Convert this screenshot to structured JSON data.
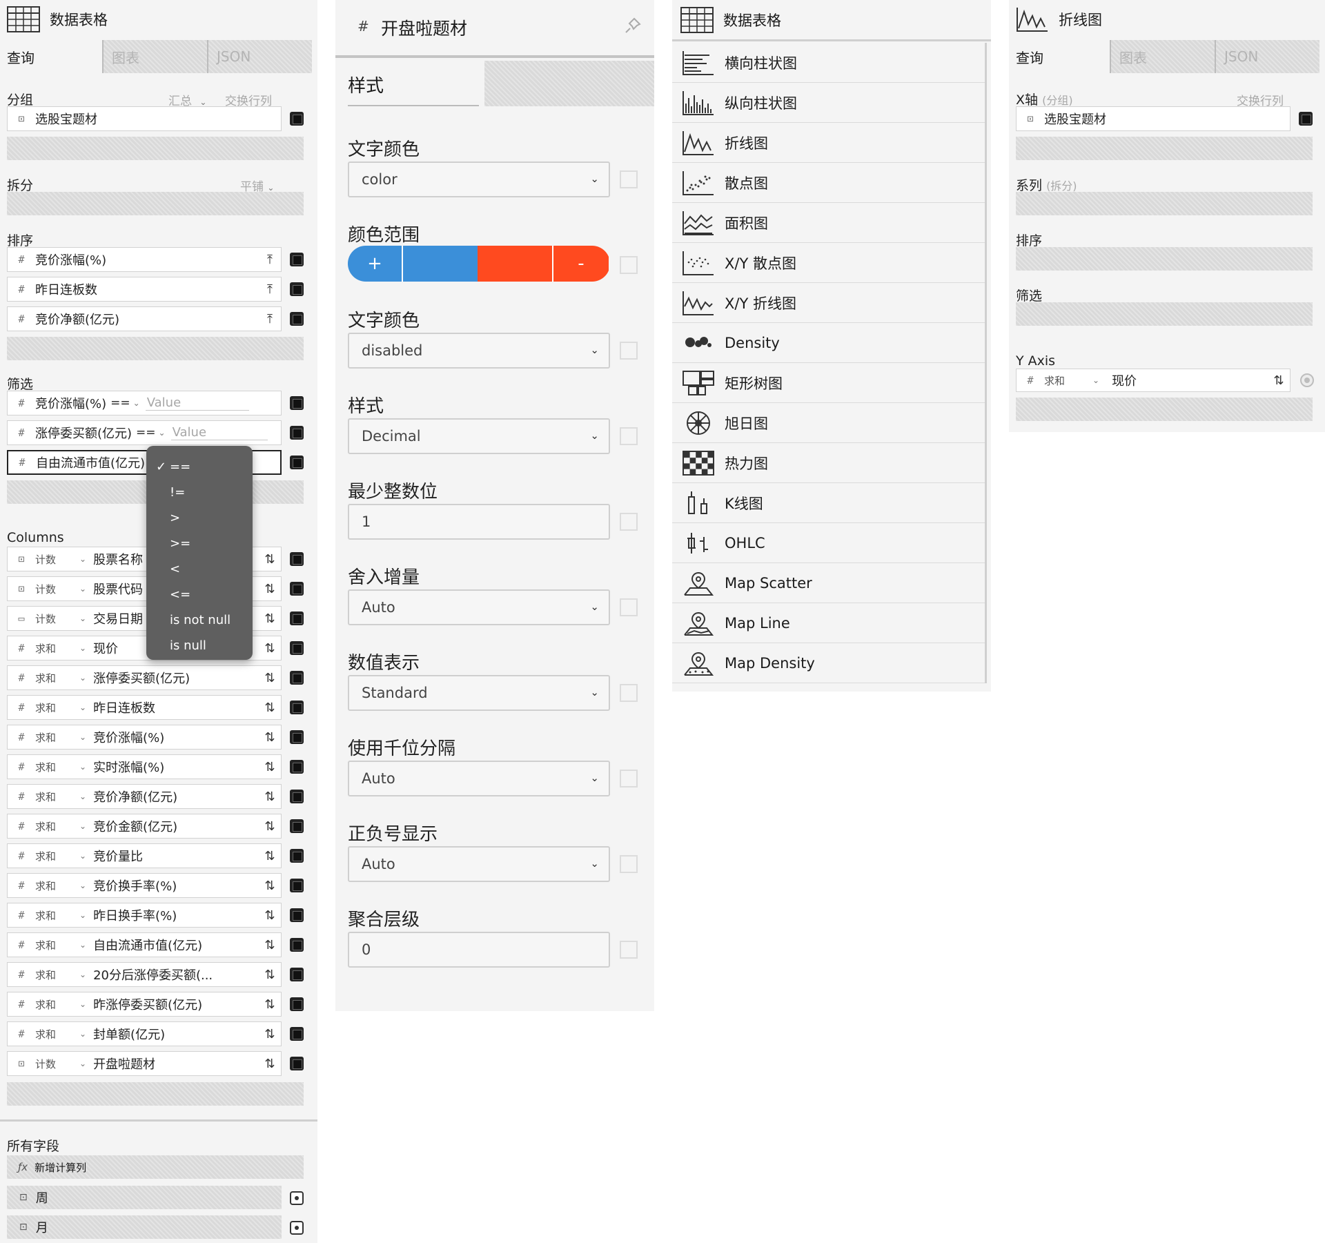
{
  "panel1": {
    "title": "数据表格",
    "tabs": [
      "查询",
      "图表",
      "JSON"
    ],
    "group": {
      "label": "分组",
      "aggregate": "汇总",
      "swap": "交换行列",
      "pill": "选股宝题材"
    },
    "split": {
      "label": "拆分",
      "mode": "平铺"
    },
    "sort": {
      "label": "排序",
      "items": [
        "竞价涨幅(%)",
        "昨日连板数",
        "竞价净额(亿元)"
      ]
    },
    "filter": {
      "label": "筛选",
      "items": [
        {
          "name": "竞价涨幅(%)",
          "op": "==",
          "value_placeholder": "Value"
        },
        {
          "name": "涨停委买额(亿元)",
          "op": "==",
          "value_placeholder": "Value"
        },
        {
          "name": "自由流通市值(亿元)",
          "op": "",
          "value_placeholder": ""
        }
      ]
    },
    "operator_menu": [
      "==",
      "!=",
      ">",
      ">=",
      "<",
      "<=",
      "is not null",
      "is null"
    ],
    "operator_selected": "==",
    "columns": {
      "label": "Columns",
      "items": [
        {
          "agg": "计数",
          "name": "股票名称",
          "type": "text"
        },
        {
          "agg": "计数",
          "name": "股票代码",
          "type": "text"
        },
        {
          "agg": "计数",
          "name": "交易日期",
          "type": "date"
        },
        {
          "agg": "求和",
          "name": "现价",
          "type": "number"
        },
        {
          "agg": "求和",
          "name": "涨停委买额(亿元)",
          "type": "number"
        },
        {
          "agg": "求和",
          "name": "昨日连板数",
          "type": "number"
        },
        {
          "agg": "求和",
          "name": "竞价涨幅(%)",
          "type": "number"
        },
        {
          "agg": "求和",
          "name": "实时涨幅(%)",
          "type": "number"
        },
        {
          "agg": "求和",
          "name": "竞价净额(亿元)",
          "type": "number"
        },
        {
          "agg": "求和",
          "name": "竞价金额(亿元)",
          "type": "number"
        },
        {
          "agg": "求和",
          "name": "竞价量比",
          "type": "number"
        },
        {
          "agg": "求和",
          "name": "竞价换手率(%)",
          "type": "number"
        },
        {
          "agg": "求和",
          "name": "昨日换手率(%)",
          "type": "number"
        },
        {
          "agg": "求和",
          "name": "自由流通市值(亿元)",
          "type": "number"
        },
        {
          "agg": "求和",
          "name": "20分后涨停委买额(...",
          "type": "number"
        },
        {
          "agg": "求和",
          "name": "昨涨停委买额(亿元)",
          "type": "number"
        },
        {
          "agg": "求和",
          "name": "封单额(亿元)",
          "type": "number"
        },
        {
          "agg": "计数",
          "name": "开盘啦题材",
          "type": "text"
        }
      ]
    },
    "all_fields": {
      "label": "所有字段",
      "add_computed": "新增计算列",
      "items": [
        "周",
        "月"
      ]
    }
  },
  "panel2": {
    "hash": "#",
    "title": "开盘啦题材",
    "tab": "样式",
    "fields": [
      {
        "label": "文字颜色",
        "value": "color"
      },
      {
        "label": "颜色范围",
        "value": ""
      },
      {
        "label": "文字颜色",
        "value": "disabled"
      },
      {
        "label": "样式",
        "value": "Decimal"
      },
      {
        "label": "最少整数位",
        "value": "1"
      },
      {
        "label": "舍入增量",
        "value": "Auto"
      },
      {
        "label": "数值表示",
        "value": "Standard"
      },
      {
        "label": "使用千位分隔",
        "value": "Auto"
      },
      {
        "label": "正负号显示",
        "value": "Auto"
      },
      {
        "label": "聚合层级",
        "value": "0"
      }
    ],
    "color_range": {
      "plus": "+",
      "minus": "-",
      "pos_color": "#3b8fd9",
      "neg_color": "#ff4a1f"
    }
  },
  "panel3": {
    "title": "数据表格",
    "items": [
      "横向柱状图",
      "纵向柱状图",
      "折线图",
      "散点图",
      "面积图",
      "X/Y 散点图",
      "X/Y 折线图",
      "Density",
      "矩形树图",
      "旭日图",
      "热力图",
      "K线图",
      "OHLC",
      "Map Scatter",
      "Map Line",
      "Map Density"
    ]
  },
  "panel4": {
    "title": "折线图",
    "tabs": [
      "查询",
      "图表",
      "JSON"
    ],
    "xaxis": {
      "label": "X轴",
      "sub": "(分组)",
      "swap": "交换行列",
      "pill": "选股宝题材"
    },
    "series": {
      "label": "系列",
      "sub": "(拆分)"
    },
    "sort_label": "排序",
    "filter_label": "筛选",
    "yaxis": {
      "label": "Y Axis",
      "agg": "求和",
      "name": "现价"
    }
  }
}
